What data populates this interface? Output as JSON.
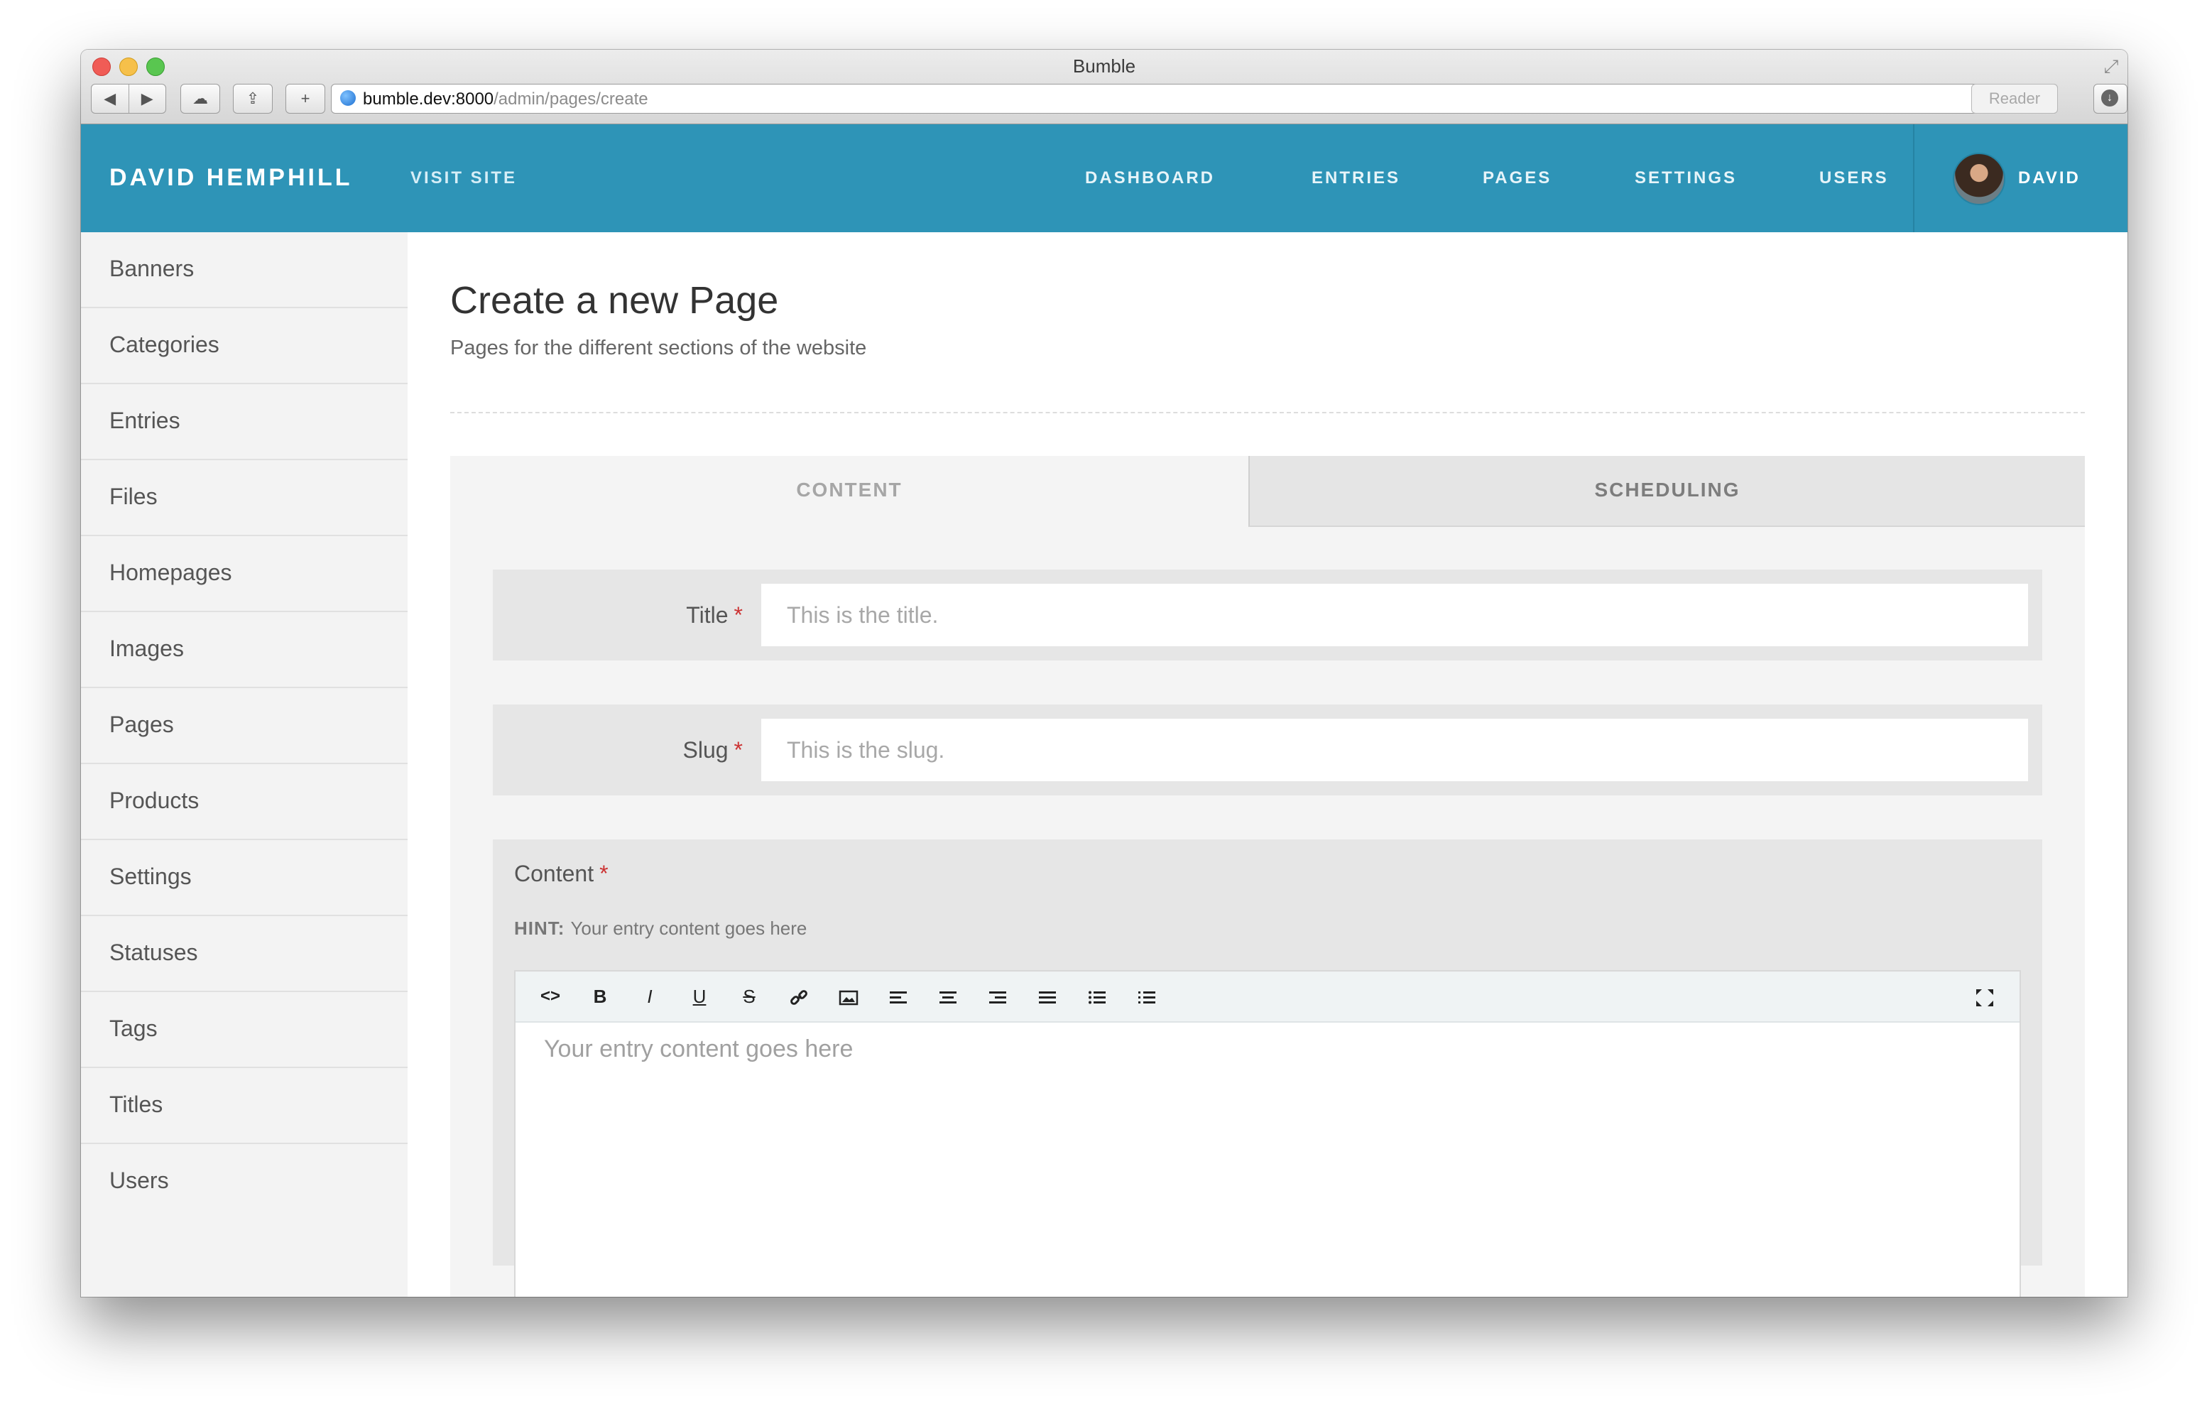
{
  "browser": {
    "window_title": "Bumble",
    "url_host": "bumble.dev:8000",
    "url_path": "/admin/pages/create",
    "reader_label": "Reader"
  },
  "header": {
    "brand": "DAVID HEMPHILL",
    "visit_site": "VISIT SITE",
    "nav": [
      "DASHBOARD",
      "ENTRIES",
      "PAGES",
      "SETTINGS",
      "USERS"
    ],
    "user": "DAVID"
  },
  "sidebar": {
    "items": [
      "Banners",
      "Categories",
      "Entries",
      "Files",
      "Homepages",
      "Images",
      "Pages",
      "Products",
      "Settings",
      "Statuses",
      "Tags",
      "Titles",
      "Users"
    ]
  },
  "main": {
    "title": "Create a new Page",
    "subtitle": "Pages for the different sections of the website",
    "tabs": [
      "CONTENT",
      "SCHEDULING"
    ],
    "fields": {
      "title_label": "Title",
      "title_placeholder": "This is the title.",
      "slug_label": "Slug",
      "slug_placeholder": "This is the slug.",
      "required_mark": "*"
    },
    "content": {
      "label": "Content",
      "hint_label": "HINT:",
      "hint_text": "Your entry content goes here",
      "editor_placeholder": "Your entry content goes here"
    }
  },
  "colors": {
    "header_bg": "#2e94b7",
    "required": "#cc3333"
  },
  "icons": {
    "toolbar": [
      "code-icon",
      "bold-icon",
      "italic-icon",
      "underline-icon",
      "strikethrough-icon",
      "link-icon",
      "image-icon",
      "align-left-icon",
      "align-center-icon",
      "align-right-icon",
      "justify-icon",
      "bullet-list-icon",
      "numbered-list-icon",
      "fullscreen-icon"
    ]
  }
}
